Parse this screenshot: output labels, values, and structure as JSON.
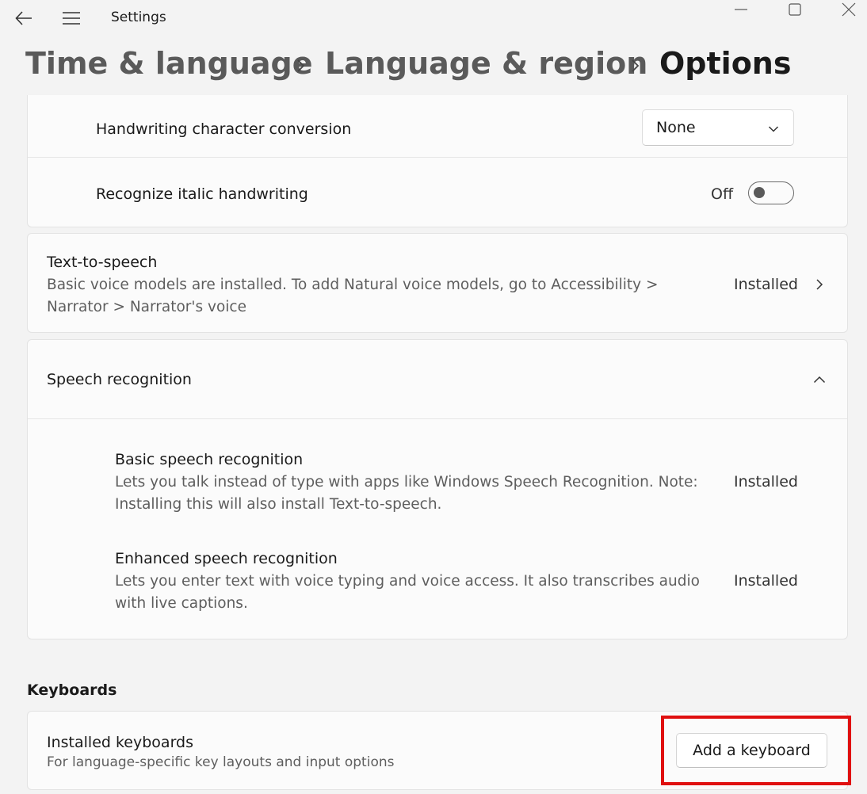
{
  "window": {
    "title": "Settings",
    "back_icon": "back-arrow-icon",
    "menu_icon": "hamburger-menu-icon",
    "controls": [
      "minimize-icon",
      "maximize-icon",
      "close-icon"
    ]
  },
  "breadcrumb": {
    "items": [
      "Time & language",
      "Language & region",
      "Options"
    ]
  },
  "handwriting": {
    "conversion_label": "Handwriting character conversion",
    "conversion_value": "None",
    "italic_label": "Recognize italic handwriting",
    "italic_state": "Off"
  },
  "tts": {
    "title": "Text-to-speech",
    "description": "Basic voice models are installed. To add Natural voice models, go to Accessibility > Narrator > Narrator's voice",
    "status": "Installed"
  },
  "speech": {
    "title": "Speech recognition",
    "items": [
      {
        "title": "Basic speech recognition",
        "description": "Lets you talk instead of type with apps like Windows Speech Recognition. Note: Installing this will also install Text-to-speech.",
        "status": "Installed"
      },
      {
        "title": "Enhanced speech recognition",
        "description": "Lets you enter text with voice typing and voice access. It also transcribes audio with live captions.",
        "status": "Installed"
      }
    ]
  },
  "keyboards": {
    "section_title": "Keyboards",
    "installed_title": "Installed keyboards",
    "installed_desc": "For language-specific key layouts and input options",
    "add_button": "Add a keyboard"
  },
  "colors": {
    "highlight": "#e01010",
    "background": "#f3f3f3",
    "card": "#fbfbfb"
  }
}
